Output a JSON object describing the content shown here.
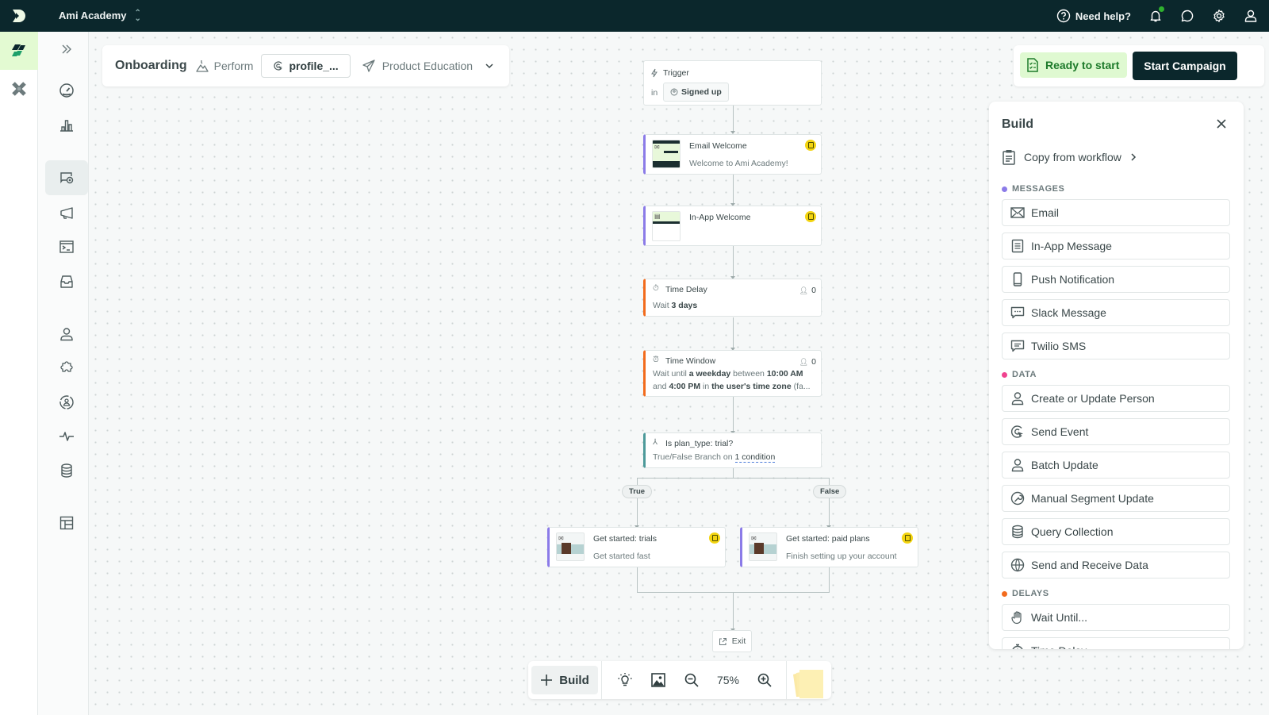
{
  "topbar": {
    "workspace": "Ami Academy",
    "help_label": "Need help?",
    "icons": [
      "help-circle-icon",
      "bell-icon",
      "chat-icon",
      "gear-icon",
      "user-icon"
    ]
  },
  "rail": {
    "apps": [
      "journeys-app",
      "other-app"
    ]
  },
  "nav": {
    "items": [
      "expand",
      "dashboard",
      "analytics",
      "campaigns",
      "broadcasts",
      "transactional",
      "inbox",
      "people",
      "integrations",
      "segments",
      "activity",
      "data",
      "objects"
    ],
    "active": "campaigns"
  },
  "header": {
    "title": "Onboarding",
    "trigger_type": "Perform",
    "event": "profile_...",
    "goal": "Product Education"
  },
  "status": {
    "ready_label": "Ready to start",
    "start_label": "Start Campaign"
  },
  "workflow": {
    "trigger": {
      "title": "Trigger",
      "in_label": "in",
      "segment": "Signed up"
    },
    "email_welcome": {
      "title": "Email Welcome",
      "subject": "Welcome to Ami Academy!"
    },
    "inapp_welcome": {
      "title": "In-App Welcome"
    },
    "time_delay": {
      "title": "Time Delay",
      "count": "0",
      "prefix": "Wait ",
      "value": "3 days"
    },
    "time_window": {
      "title": "Time Window",
      "count": "0",
      "line1_a": "Wait until ",
      "line1_b": "a weekday",
      "line1_c": " between ",
      "line1_d": "10:00 AM",
      "line2_a": "and ",
      "line2_b": "4:00 PM",
      "line2_c": " in ",
      "line2_d": "the user's time zone",
      "line2_e": " (fa..."
    },
    "branch": {
      "title": "Is plan_type: trial?",
      "sub_prefix": "True/False Branch on ",
      "sub_link": "1 condition"
    },
    "true_label": "True",
    "false_label": "False",
    "trials": {
      "title": "Get started: trials",
      "subject": "Get started fast"
    },
    "paid": {
      "title": "Get started: paid plans",
      "subject": "Finish setting up your account"
    },
    "exit_label": "Exit"
  },
  "toolbar": {
    "build_label": "Build",
    "zoom_level": "75%"
  },
  "build_panel": {
    "title": "Build",
    "copy_label": "Copy from workflow",
    "sections": [
      {
        "name": "MESSAGES",
        "color": "#8b7be8",
        "items": [
          "Email",
          "In-App Message",
          "Push Notification",
          "Slack Message",
          "Twilio SMS"
        ]
      },
      {
        "name": "DATA",
        "color": "#f0428f",
        "items": [
          "Create or Update Person",
          "Send Event",
          "Batch Update",
          "Manual Segment Update",
          "Query Collection",
          "Send and Receive Data"
        ]
      },
      {
        "name": "DELAYS",
        "color": "#f26b1d",
        "items": [
          "Wait Until...",
          "Time Delay"
        ]
      }
    ]
  }
}
